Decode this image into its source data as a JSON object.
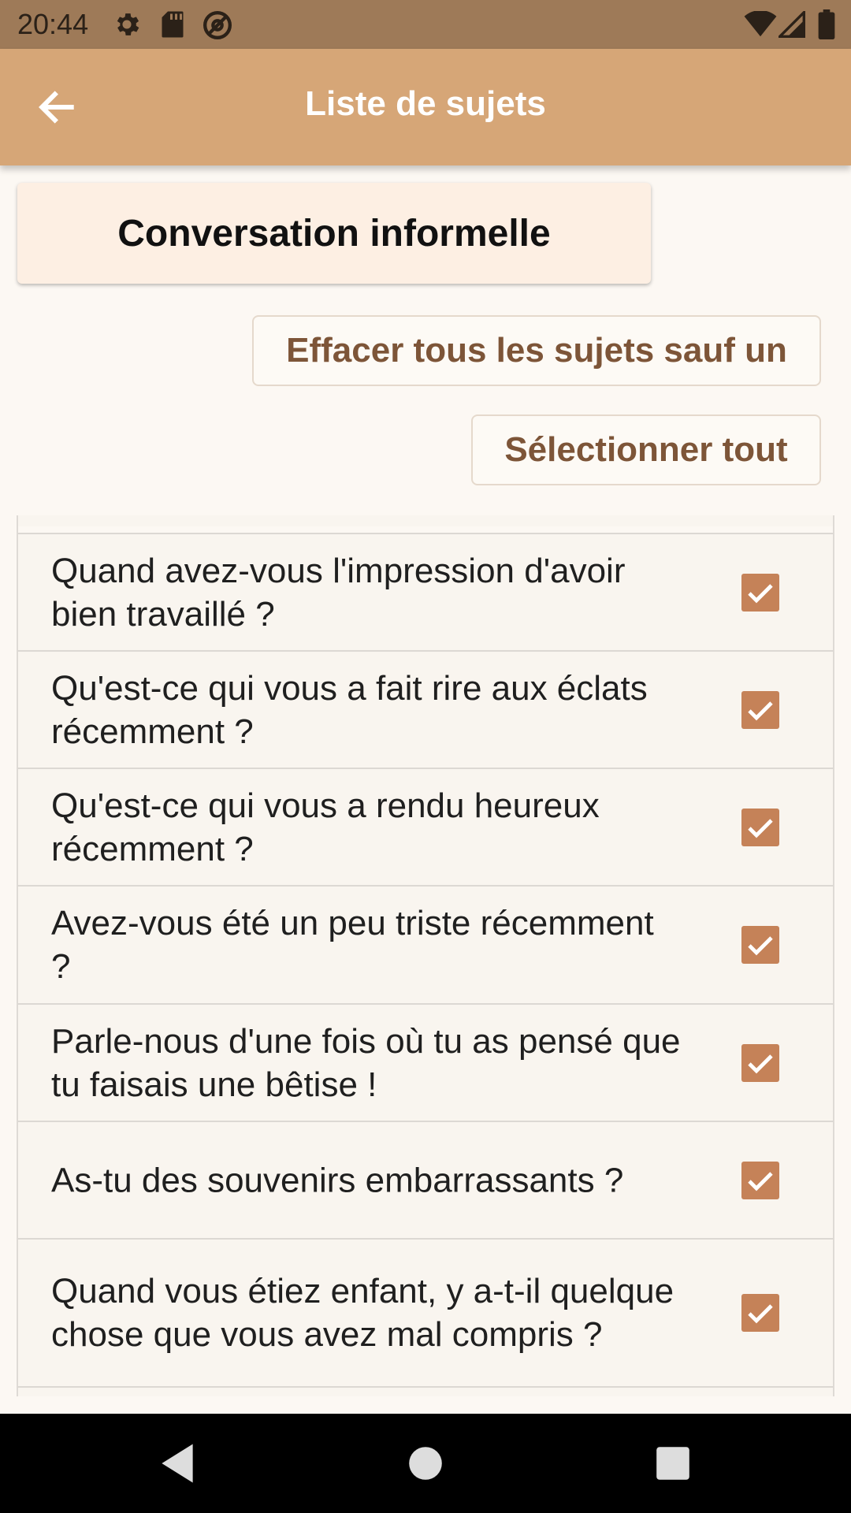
{
  "status_bar": {
    "time": "20:44",
    "left_icons": [
      "gear-icon",
      "sd-card-icon",
      "at-sign-icon"
    ],
    "right_icons": [
      "wifi-icon",
      "signal-icon",
      "battery-icon"
    ]
  },
  "app_bar": {
    "title": "Liste de sujets",
    "back_icon": "arrow-left-icon"
  },
  "category": {
    "label": "Conversation informelle"
  },
  "actions": {
    "clear_label": "Effacer tous les sujets sauf un",
    "select_all_label": "Sélectionner tout"
  },
  "topics": [
    {
      "text": "Quand avez-vous l'impression d'avoir bien travaillé ?",
      "checked": true
    },
    {
      "text": "Qu'est-ce qui vous a fait rire aux éclats récemment ?",
      "checked": true
    },
    {
      "text": "Qu'est-ce qui vous a rendu heureux récemment ?",
      "checked": true
    },
    {
      "text": "Avez-vous été un peu triste récemment ?",
      "checked": true
    },
    {
      "text": "Parle-nous d'une fois où tu as pensé que tu faisais une bêtise !",
      "checked": true
    },
    {
      "text": "As-tu des souvenirs embarrassants ?",
      "checked": true
    },
    {
      "text": "Quand vous étiez enfant, y a-t-il quelque chose que vous avez mal compris ?",
      "checked": true
    }
  ],
  "colors": {
    "status_bar": "#9e7a58",
    "app_bar": "#d6a677",
    "accent": "#c58258",
    "button_text": "#7d5538",
    "background": "#fcf8f3"
  },
  "nav_bar": {
    "icons": [
      "back-triangle-icon",
      "home-circle-icon",
      "recents-square-icon"
    ]
  }
}
